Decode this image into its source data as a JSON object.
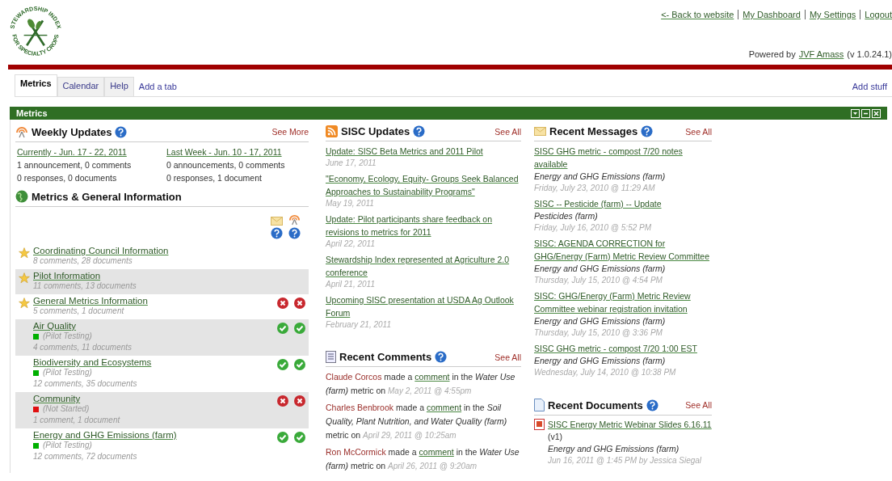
{
  "logo": {
    "top_text": "STEWARDSHIP INDEX",
    "bottom_text": "FOR SPECIALTY CROPS"
  },
  "top_links": [
    "<- Back to website",
    "My Dashboard",
    "My Settings",
    "Logout"
  ],
  "powered_by": {
    "prefix": "Powered by",
    "link": "JVF Amass",
    "version": "(v 1.0.24.1)"
  },
  "tabs": [
    {
      "label": "Metrics",
      "selected": true
    },
    {
      "label": "Calendar",
      "selected": false
    },
    {
      "label": "Help",
      "selected": false
    }
  ],
  "add_tab": "Add a tab",
  "add_stuff": "Add stuff",
  "panel": {
    "title": "Metrics"
  },
  "weekly_updates": {
    "title": "Weekly Updates",
    "see_more": "See More",
    "weeks": [
      {
        "link": "Currently - Jun. 17 - 22, 2011",
        "line1": "1 announcement, 0 comments",
        "line2": "0 responses, 0 documents"
      },
      {
        "link": "Last Week - Jun. 10 - 17, 2011",
        "line1": "0 announcements, 0 comments",
        "line2": "0 responses, 1 document"
      }
    ]
  },
  "metrics": {
    "title": "Metrics & General Information",
    "items": [
      {
        "name": "Coordinating Council Information",
        "starred": true,
        "counts": "8 comments, 28 documents"
      },
      {
        "name": "Pilot Information",
        "starred": true,
        "counts": "11 comments, 13 documents"
      },
      {
        "name": "General Metrics Information",
        "starred": true,
        "counts": "5 comments, 1 document",
        "indicators": [
          {
            "kind": "cross"
          },
          {
            "kind": "cross"
          }
        ]
      },
      {
        "name": "Air Quality",
        "starred": false,
        "status": {
          "label": "(Pilot Testing)",
          "color": "#00b000"
        },
        "counts": "4 comments, 11 documents",
        "indicators": [
          {
            "kind": "check"
          },
          {
            "kind": "check"
          }
        ]
      },
      {
        "name": "Biodiversity and Ecosystems",
        "starred": false,
        "status": {
          "label": "(Pilot Testing)",
          "color": "#00b000"
        },
        "counts": "12 comments, 35 documents",
        "indicators": [
          {
            "kind": "check"
          },
          {
            "kind": "check"
          }
        ]
      },
      {
        "name": "Community",
        "starred": false,
        "status": {
          "label": "(Not Started)",
          "color": "#e01010"
        },
        "counts": "1 comment, 1 document",
        "indicators": [
          {
            "kind": "cross"
          },
          {
            "kind": "cross"
          }
        ]
      },
      {
        "name": "Energy and GHG Emissions (farm)",
        "starred": false,
        "status": {
          "label": "(Pilot Testing)",
          "color": "#00b000"
        },
        "counts": "12 comments, 72 documents",
        "indicators": [
          {
            "kind": "check"
          },
          {
            "kind": "check"
          }
        ]
      }
    ]
  },
  "sisc_updates": {
    "title": "SISC Updates",
    "see_all": "See All",
    "items": [
      {
        "title": "Update: SISC Beta Metrics and 2011 Pilot",
        "date": "June 17, 2011"
      },
      {
        "title": "\"Economy, Ecology, Equity- Groups Seek Balanced Approaches to Sustainability Programs\"",
        "date": "May 19, 2011"
      },
      {
        "title": "Update: Pilot participants share feedback on revisions to metrics for 2011",
        "date": "April 22, 2011"
      },
      {
        "title": "Stewardship Index represented at Agriculture 2.0 conference",
        "date": "April 21, 2011"
      },
      {
        "title": "Upcoming SISC presentation at USDA Ag Outlook Forum",
        "date": "February 21, 2011"
      }
    ]
  },
  "recent_comments": {
    "title": "Recent Comments",
    "see_all": "See All",
    "items": [
      {
        "author": "Claude Corcos",
        "made": "made a",
        "link": "comment",
        "in_the": "in the",
        "metric": "Water Use (farm)",
        "metric_on": "metric on",
        "date": "May 2, 2011 @ 4:55pm"
      },
      {
        "author": "Charles Benbrook",
        "made": "made a",
        "link": "comment",
        "in_the": "in the",
        "metric": "Soil Quality, Plant Nutrition, and Water Quality (farm)",
        "metric_on": "metric on",
        "date": "April 29, 2011 @ 10:25am"
      },
      {
        "author": "Ron McCormick",
        "made": "made a",
        "link": "comment",
        "in_the": "in the",
        "metric": "Water Use (farm)",
        "metric_on": "metric on",
        "date": "April 26, 2011 @ 9:20am"
      }
    ]
  },
  "recent_messages": {
    "title": "Recent Messages",
    "see_all": "See All",
    "items": [
      {
        "title": "SISC GHG metric - compost 7/20 notes available",
        "metric": "Energy and GHG Emissions (farm)",
        "date": "Friday, July 23, 2010 @ 11:29 AM"
      },
      {
        "title": "SISC -- Pesticide (farm) -- Update",
        "metric": "Pesticides (farm)",
        "date": "Friday, July 16, 2010 @ 5:52 PM"
      },
      {
        "title": "SISC: AGENDA CORRECTION for GHG/Energy (Farm) Metric Review Committee",
        "metric": "Energy and GHG Emissions (farm)",
        "date": "Thursday, July 15, 2010 @ 4:54 PM"
      },
      {
        "title": "SISC: GHG/Energy (Farm) Metric Review Committee webinar registration invitation",
        "metric": "Energy and GHG Emissions (farm)",
        "date": "Thursday, July 15, 2010 @ 3:36 PM"
      },
      {
        "title": "SISC GHG metric - compost 7/20 1:00 EST",
        "metric": "Energy and GHG Emissions (farm)",
        "date": "Wednesday, July 14, 2010 @ 10:38 PM"
      }
    ]
  },
  "recent_documents": {
    "title": "Recent Documents",
    "see_all": "See All",
    "items": [
      {
        "title": "SISC Energy Metric Webinar Slides 6.16.11",
        "version": "(v1)",
        "metric": "Energy and GHG Emissions (farm)",
        "meta": "Jun 16, 2011 @ 1:45 PM by Jessica Siegal"
      }
    ]
  }
}
